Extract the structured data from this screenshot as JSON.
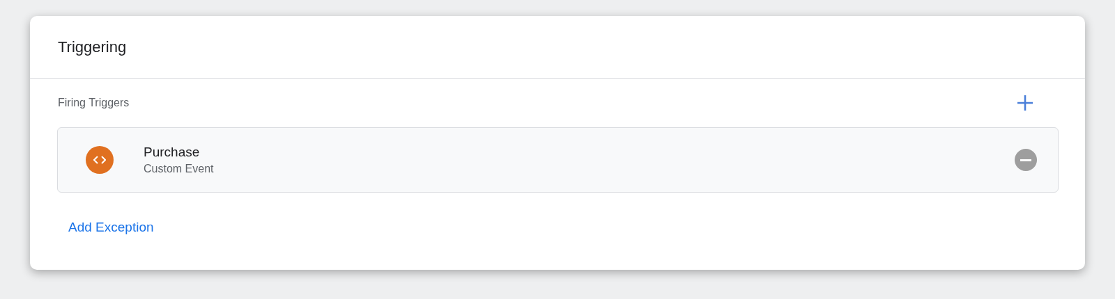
{
  "card": {
    "title": "Triggering"
  },
  "firing_triggers": {
    "label": "Firing Triggers",
    "items": [
      {
        "name": "Purchase",
        "type": "Custom Event"
      }
    ]
  },
  "add_exception": "Add Exception"
}
